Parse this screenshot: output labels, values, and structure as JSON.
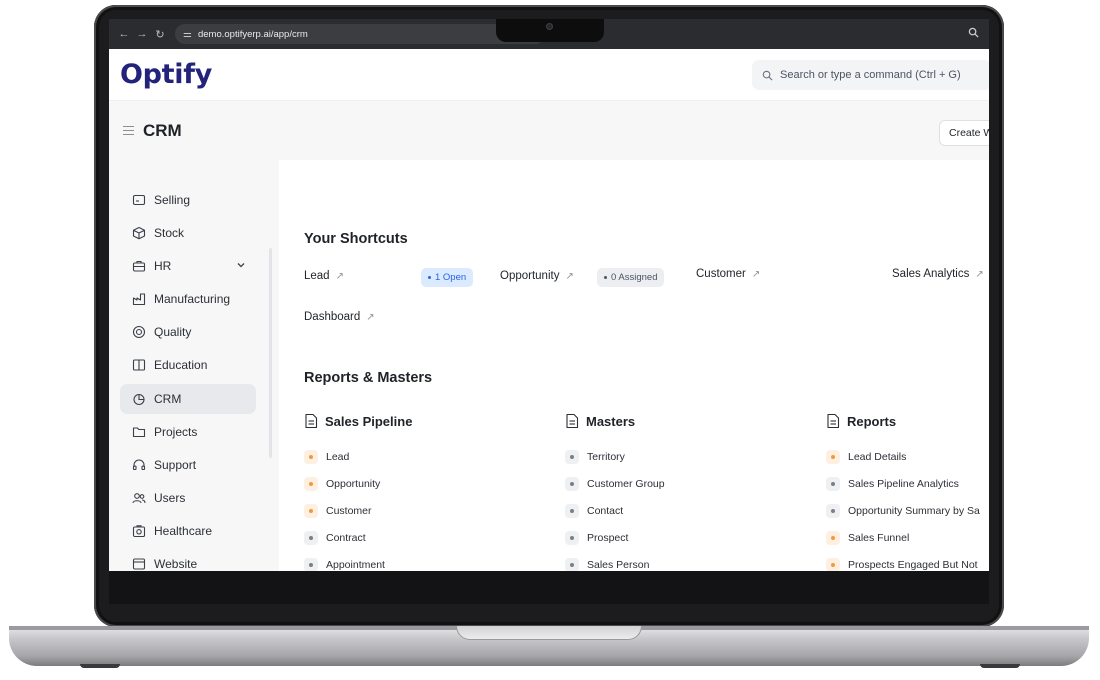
{
  "browser": {
    "url": "demo.optifyerp.ai/app/crm"
  },
  "app": {
    "logo": "Optify",
    "brand_color": "#23237c"
  },
  "search": {
    "placeholder": "Search or type a command (Ctrl + G)"
  },
  "page": {
    "title": "CRM",
    "create_button": "Create W"
  },
  "sidebar": {
    "items": [
      {
        "label": "Selling",
        "icon": "wallet-icon"
      },
      {
        "label": "Stock",
        "icon": "box-icon"
      },
      {
        "label": "HR",
        "icon": "briefcase-icon",
        "expandable": true
      },
      {
        "label": "Manufacturing",
        "icon": "factory-icon"
      },
      {
        "label": "Quality",
        "icon": "badge-icon"
      },
      {
        "label": "Education",
        "icon": "book-icon"
      },
      {
        "label": "CRM",
        "icon": "crm-icon",
        "active": true
      },
      {
        "label": "Projects",
        "icon": "folder-icon"
      },
      {
        "label": "Support",
        "icon": "headset-icon"
      },
      {
        "label": "Users",
        "icon": "users-icon"
      },
      {
        "label": "Healthcare",
        "icon": "healthcare-icon"
      },
      {
        "label": "Website",
        "icon": "browser-icon"
      }
    ]
  },
  "shortcuts": {
    "title": "Your Shortcuts",
    "items": [
      {
        "label": "Lead",
        "badge": "1 Open",
        "badge_color": "blue"
      },
      {
        "label": "Opportunity",
        "badge": "0 Assigned",
        "badge_color": "gray"
      },
      {
        "label": "Customer"
      },
      {
        "label": "Sales Analytics"
      },
      {
        "label": "Dashboard"
      }
    ]
  },
  "reports": {
    "title": "Reports & Masters",
    "columns": [
      {
        "title": "Sales Pipeline",
        "links": [
          {
            "label": "Lead",
            "color": "orange"
          },
          {
            "label": "Opportunity",
            "color": "orange"
          },
          {
            "label": "Customer",
            "color": "orange"
          },
          {
            "label": "Contract",
            "color": "gray"
          },
          {
            "label": "Appointment",
            "color": "gray"
          }
        ]
      },
      {
        "title": "Masters",
        "links": [
          {
            "label": "Territory",
            "color": "gray"
          },
          {
            "label": "Customer Group",
            "color": "gray"
          },
          {
            "label": "Contact",
            "color": "gray"
          },
          {
            "label": "Prospect",
            "color": "gray"
          },
          {
            "label": "Sales Person",
            "color": "gray"
          }
        ]
      },
      {
        "title": "Reports",
        "links": [
          {
            "label": "Lead Details",
            "color": "orange"
          },
          {
            "label": "Sales Pipeline Analytics",
            "color": "gray"
          },
          {
            "label": "Opportunity Summary by Sa",
            "color": "gray"
          },
          {
            "label": "Sales Funnel",
            "color": "orange"
          },
          {
            "label": "Prospects Engaged But Not",
            "color": "orange"
          }
        ]
      }
    ]
  }
}
